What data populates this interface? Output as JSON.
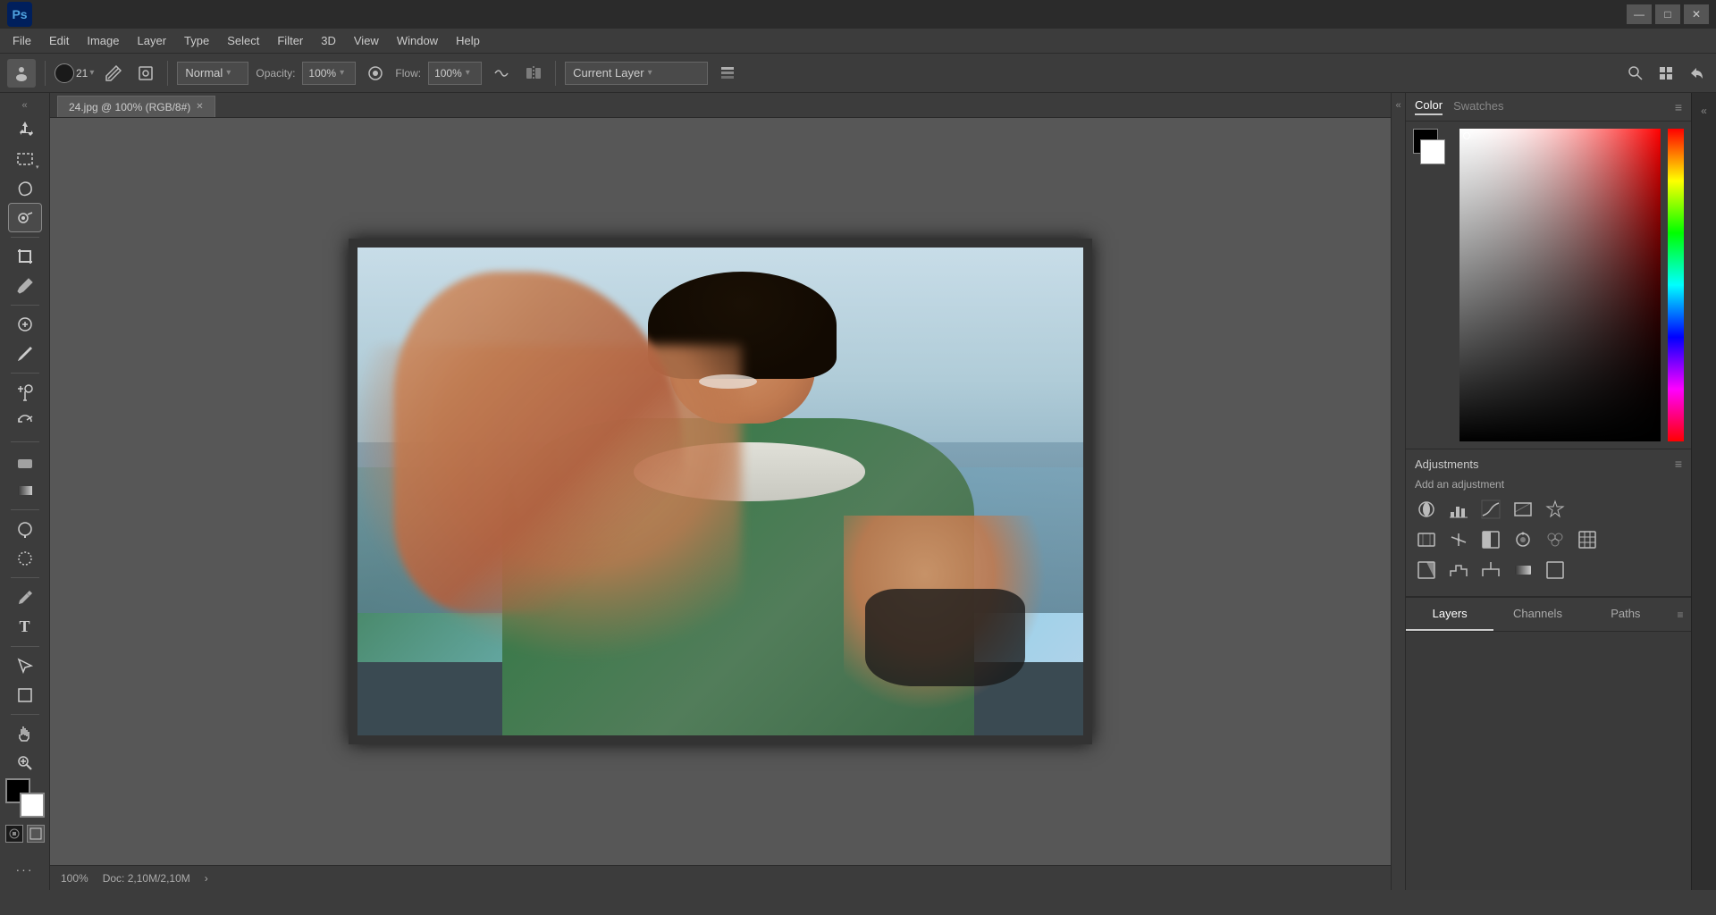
{
  "app": {
    "name": "Adobe Photoshop",
    "logo": "Ps",
    "title_bar": {
      "minimize": "—",
      "maximize": "□",
      "close": "✕"
    }
  },
  "menu": {
    "items": [
      "File",
      "Edit",
      "Image",
      "Layer",
      "Type",
      "Select",
      "Filter",
      "3D",
      "View",
      "Window",
      "Help"
    ]
  },
  "options_bar": {
    "brush_size": "21",
    "blend_mode": "Normal",
    "blend_mode_arrow": "▾",
    "opacity_label": "Opacity:",
    "opacity_value": "100%",
    "flow_label": "Flow:",
    "flow_value": "100%",
    "sample_label": "Current Layer",
    "sample_arrow": "▾"
  },
  "toolbar": {
    "tools": [
      {
        "name": "move-tool",
        "icon": "✛",
        "label": "Move Tool"
      },
      {
        "name": "marquee-tool",
        "icon": "▭",
        "label": "Marquee Tool"
      },
      {
        "name": "lasso-tool",
        "icon": "⌒",
        "label": "Lasso Tool"
      },
      {
        "name": "quick-select-tool",
        "icon": "⬤",
        "label": "Quick Select Tool"
      },
      {
        "name": "crop-tool",
        "icon": "⊡",
        "label": "Crop Tool"
      },
      {
        "name": "eyedropper-tool",
        "icon": "🖈",
        "label": "Eyedropper Tool"
      },
      {
        "name": "healing-brush-tool",
        "icon": "⊕",
        "label": "Healing Brush"
      },
      {
        "name": "brush-tool",
        "icon": "✏",
        "label": "Brush Tool"
      },
      {
        "name": "clone-tool",
        "icon": "⎘",
        "label": "Clone Stamp"
      },
      {
        "name": "history-brush-tool",
        "icon": "↩",
        "label": "History Brush"
      },
      {
        "name": "eraser-tool",
        "icon": "◻",
        "label": "Eraser"
      },
      {
        "name": "gradient-tool",
        "icon": "▓",
        "label": "Gradient Tool"
      },
      {
        "name": "dodge-tool",
        "icon": "○",
        "label": "Dodge Tool"
      },
      {
        "name": "pen-tool",
        "icon": "✒",
        "label": "Pen Tool"
      },
      {
        "name": "type-tool",
        "icon": "T",
        "label": "Type Tool"
      },
      {
        "name": "path-select-tool",
        "icon": "▷",
        "label": "Path Selection"
      },
      {
        "name": "shape-tool",
        "icon": "□",
        "label": "Shape Tool"
      },
      {
        "name": "hand-tool",
        "icon": "✋",
        "label": "Hand Tool"
      },
      {
        "name": "zoom-tool",
        "icon": "🔍",
        "label": "Zoom Tool"
      },
      {
        "name": "extra-tools",
        "icon": "…",
        "label": "More Tools"
      }
    ]
  },
  "document": {
    "filename": "24.jpg @ 100% (RGB/8#)",
    "close_btn": "✕"
  },
  "status_bar": {
    "zoom": "100%",
    "doc_info": "Doc: 2,10M/2,10M",
    "arrow": "›"
  },
  "color_panel": {
    "tabs": [
      "Color",
      "Swatches"
    ],
    "active_tab": "Color",
    "menu_icon": "≡",
    "foreground": "#000000",
    "background": "#ffffff"
  },
  "adjustments_panel": {
    "title": "Adjustments",
    "subtitle": "Add an adjustment",
    "menu_icon": "≡",
    "icons_row1": [
      "☀",
      "📊",
      "⊞",
      "⊠",
      "▽"
    ],
    "icons_row2": [
      "⊡",
      "⚖",
      "⊟",
      "📷",
      "◎",
      "⊞"
    ],
    "icons_row3": [
      "◨",
      "◧",
      "⊠",
      "✉",
      "□"
    ]
  },
  "layers_panel": {
    "tabs": [
      "Layers",
      "Channels",
      "Paths"
    ],
    "active_tab": "Layers",
    "menu_icon": "≡"
  },
  "far_right": {
    "collapse_icon": "«"
  }
}
